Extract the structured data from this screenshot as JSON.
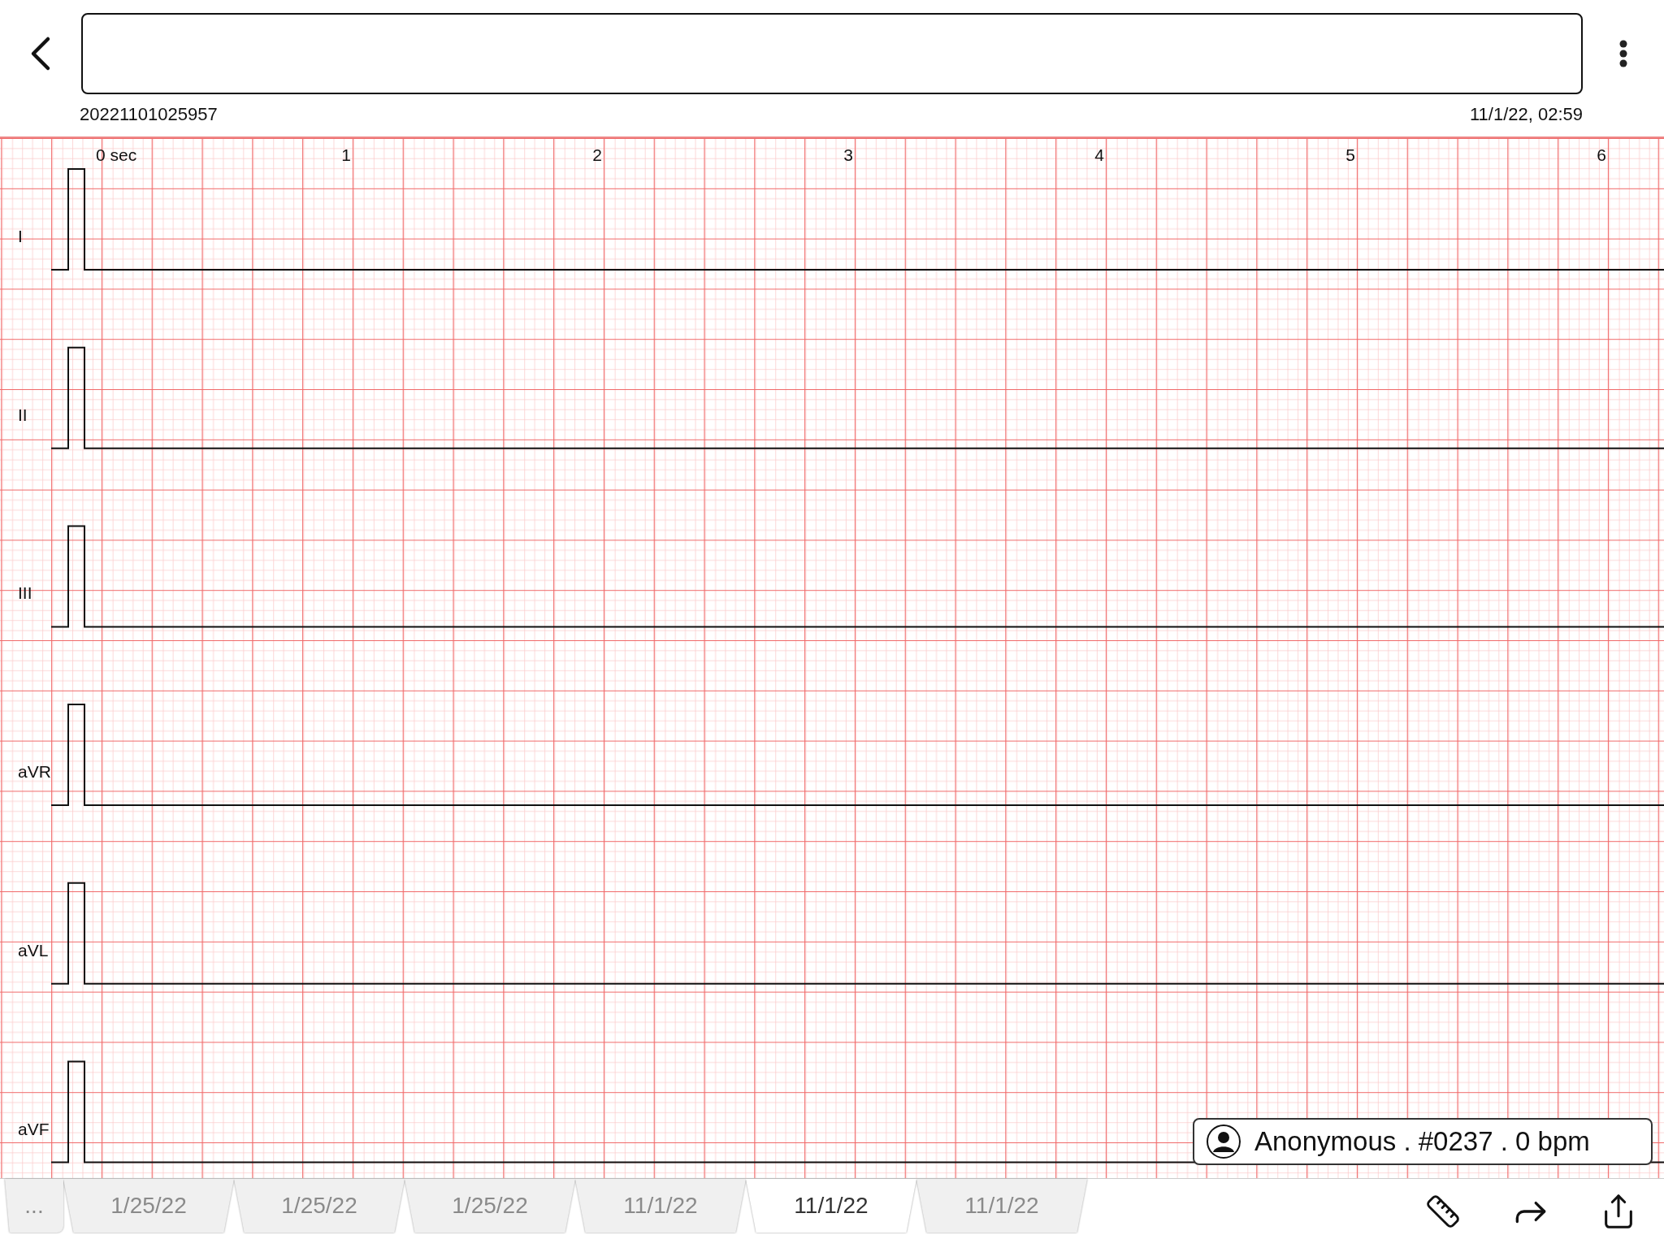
{
  "header": {
    "recording_id": "20221101025957",
    "timestamp": "11/1/22, 02:59"
  },
  "chart": {
    "time_labels": [
      "0 sec",
      "1",
      "2",
      "3",
      "4",
      "5",
      "6"
    ],
    "leads": [
      {
        "label": "I"
      },
      {
        "label": "II"
      },
      {
        "label": "III"
      },
      {
        "label": "aVR"
      },
      {
        "label": "aVL"
      },
      {
        "label": "aVF"
      }
    ]
  },
  "patient_badge": {
    "text": "Anonymous . #0237 . 0 bpm"
  },
  "tabs": [
    {
      "label": "...",
      "selected": false
    },
    {
      "label": "1/25/22",
      "selected": false
    },
    {
      "label": "1/25/22",
      "selected": false
    },
    {
      "label": "1/25/22",
      "selected": false
    },
    {
      "label": "11/1/22",
      "selected": false
    },
    {
      "label": "11/1/22",
      "selected": true
    },
    {
      "label": "11/1/22",
      "selected": false
    }
  ]
}
